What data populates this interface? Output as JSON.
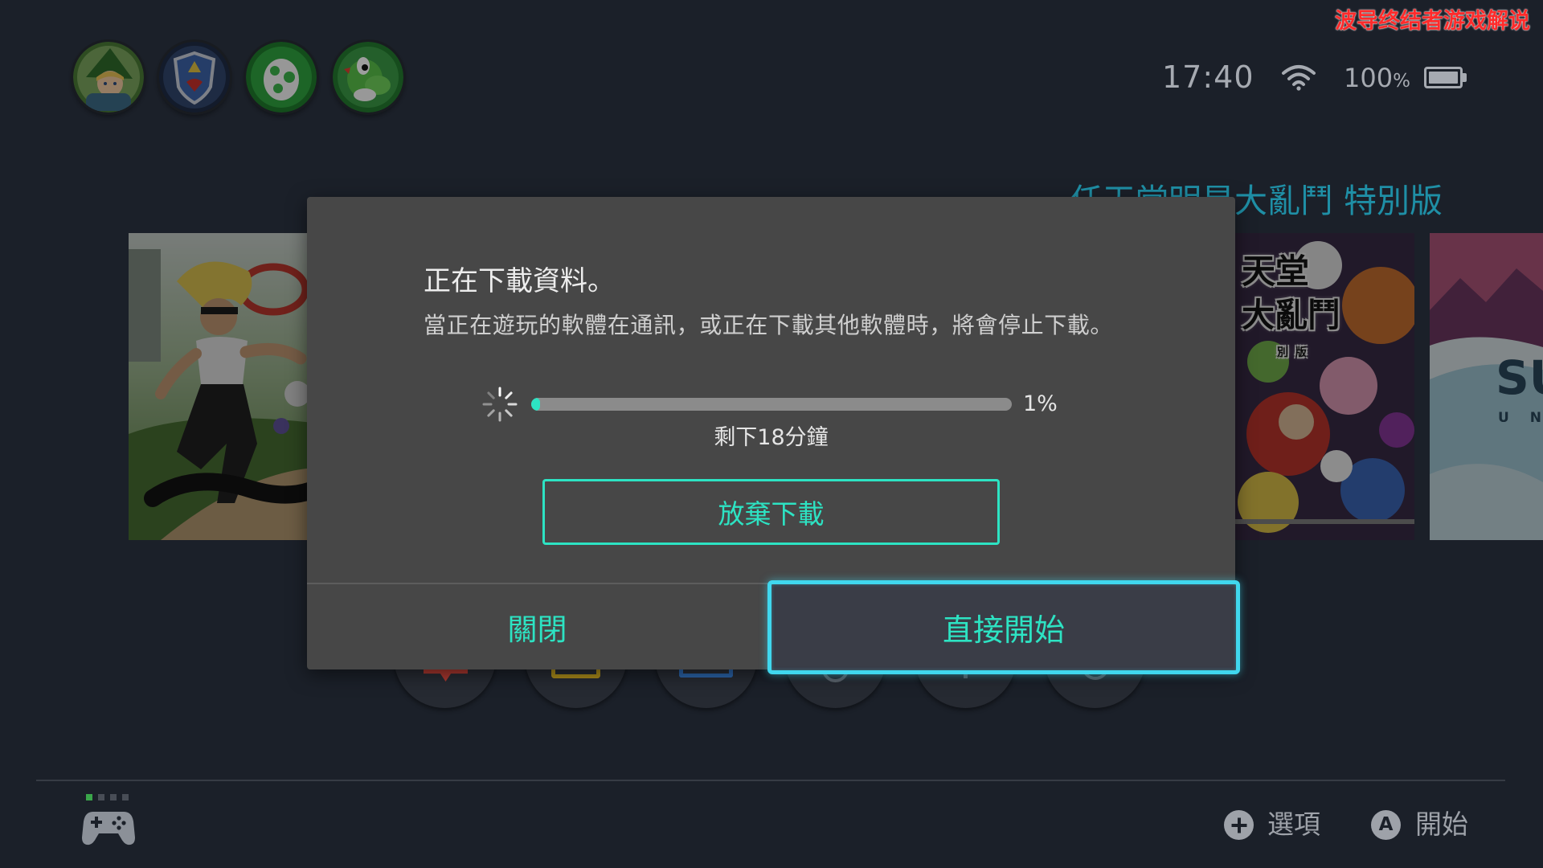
{
  "watermark": "波导终结者游戏解说",
  "users": [
    {
      "icon": "link-avatar"
    },
    {
      "icon": "hylian-shield-avatar"
    },
    {
      "icon": "yoshi-egg-avatar"
    },
    {
      "icon": "yoshi-avatar"
    }
  ],
  "status": {
    "time": "17:40",
    "wifi_icon": "wifi-icon",
    "battery_level": "100",
    "battery_unit": "%",
    "battery_icon": "battery-full-icon",
    "battery_fraction": 1.0
  },
  "featured_title": "任天堂明星大亂鬥 特別版",
  "games": [
    {
      "icon": "ring-fit-adventure-tile"
    },
    {
      "icon": "super-smash-bros-ultimate-tile",
      "logo_lines": [
        "天堂",
        "大亂鬥",
        "別 版"
      ]
    },
    {
      "icon": "game-tile",
      "logo_lines": [
        "SU",
        "U N"
      ]
    }
  ],
  "home_menu": [
    {
      "icon": "news-icon"
    },
    {
      "icon": "eshop-icon"
    },
    {
      "icon": "album-icon"
    },
    {
      "icon": "controllers-icon"
    },
    {
      "icon": "system-settings-icon"
    },
    {
      "icon": "sleep-mode-icon"
    }
  ],
  "dialog": {
    "title": "正在下載資料。",
    "message": "當正在遊玩的軟體在通訊，或正在下載其他軟體時，將會停止下載。",
    "spinner_icon": "loading-spinner-icon",
    "progress": 0.01,
    "progress_label": "1%",
    "time_remaining": "剩下18分鐘",
    "cancel_download_label": "放棄下載",
    "close_label": "關閉",
    "start_label": "直接開始",
    "focused_button": "start"
  },
  "footer": {
    "controller_icon": "controller-icon",
    "player_indicator": {
      "active": 1,
      "total": 4
    },
    "plus_button_icon": "plus-button-icon",
    "options_label": "選項",
    "a_button_letter": "A",
    "start_label": "開始"
  },
  "colors": {
    "background": "#1b2029",
    "dialog": "#474747",
    "accent": "#2de3c3",
    "focus_ring": "#40d7ee",
    "featured_title": "#1f8fa6",
    "watermark": "#ff2b2b",
    "player_active": "#3aa64a"
  }
}
